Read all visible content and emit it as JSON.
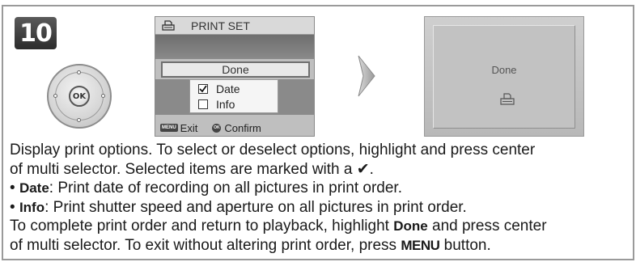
{
  "step": {
    "number": "10"
  },
  "multi_selector": {
    "center_label": "OK"
  },
  "print_set_screen": {
    "title": "PRINT SET",
    "done_label": "Done",
    "options": [
      {
        "label": "Date",
        "checked": true
      },
      {
        "label": "Info",
        "checked": false
      }
    ],
    "footer": {
      "menu_key": "MENU",
      "exit_label": "Exit",
      "ok_key": "OK",
      "confirm_label": "Confirm"
    }
  },
  "done_screen": {
    "text": "Done"
  },
  "body": {
    "line1": "Display print options.  To select or deselect options, highlight and press center",
    "line2_pre": "of multi selector.  Selected items are marked with a ",
    "check_glyph": "✔",
    "line2_post": ".",
    "bullet": "•",
    "date_term": "Date",
    "date_desc": ": Print date of recording on all pictures in print order.",
    "info_term": "Info",
    "info_desc": ": Print shutter speed and aperture on all pictures in print order.",
    "line5_pre": "To complete print order and return to playback, highlight ",
    "line5_done": "Done",
    "line5_post": " and press center",
    "line6_pre": "of multi selector.  To exit without altering print order, press ",
    "line6_menu": "MENU",
    "line6_post": " button."
  },
  "colors": {
    "badge_bg": "#3a3a3a",
    "screen_bg": "#bfbfbf",
    "frame_border": "#9a9a9a"
  }
}
